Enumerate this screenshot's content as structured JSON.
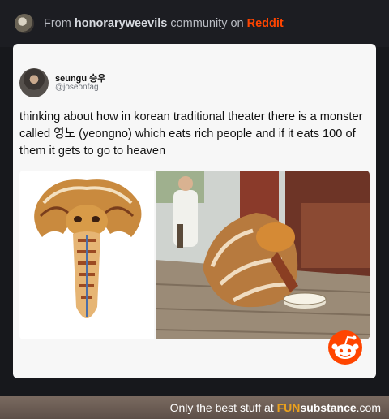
{
  "header": {
    "prefix": "From",
    "community": "honoraryweevils",
    "middle": "community on",
    "platform": "Reddit",
    "platform_color": "#ff4500"
  },
  "tweet": {
    "display_name": "seungu 승우",
    "handle": "@joseonfag",
    "text": "thinking about how in korean traditional theater there is a monster called 영노 (yeongno) which eats rich people and if it eats 100 of them it gets to go to heaven"
  },
  "images": {
    "left": "mask-photo",
    "right": "performance-photo"
  },
  "icons": {
    "community": "community-avatar-icon",
    "mascot": "reddit-snoo-icon"
  },
  "footer": {
    "prefix": "Only the best stuff at",
    "fun": "FUN",
    "rest": "substance",
    "suffix": ".com",
    "fun_color": "#e9a11e"
  }
}
